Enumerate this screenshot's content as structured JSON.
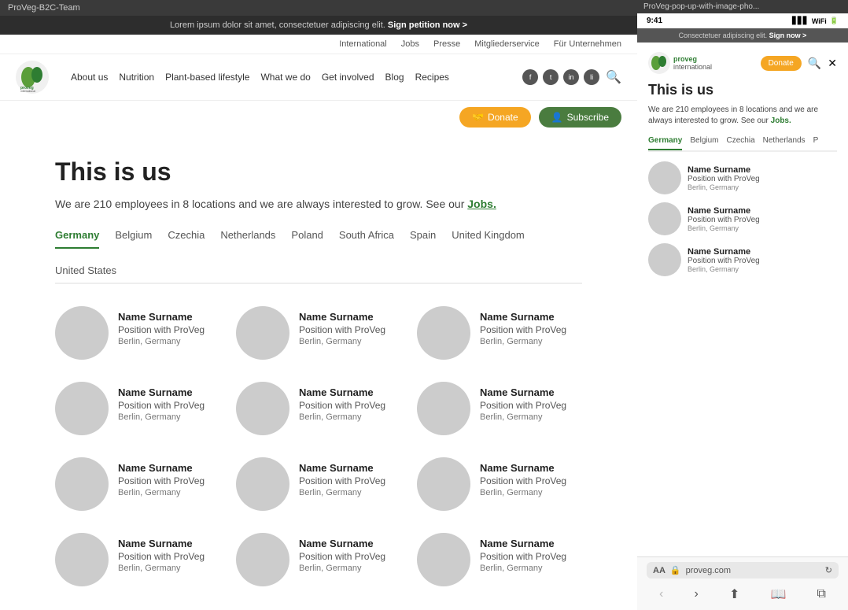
{
  "browser": {
    "left_title": "ProVeg-B2C-Team",
    "right_title": "ProVeg-pop-up-with-image-pho..."
  },
  "banner": {
    "text": "Lorem ipsum dolor sit amet, consectetuer adipiscing elit.",
    "link_text": "Sign petition now >"
  },
  "secondary_nav": {
    "items": [
      "International",
      "Jobs",
      "Presse",
      "Mitgliederservice",
      "Für Unternehmen"
    ]
  },
  "main_nav": {
    "logo_text": "proveg\ninternational",
    "links": [
      "About us",
      "Nutrition",
      "Plant-based lifestyle",
      "What we do",
      "Get involved",
      "Blog",
      "Recipes"
    ]
  },
  "action_buttons": {
    "donate": "Donate",
    "subscribe": "Subscribe"
  },
  "page": {
    "title": "This is us",
    "description": "We are 210 employees in 8 locations and we are always interested to grow. See our",
    "jobs_link": "Jobs."
  },
  "tabs": {
    "items": [
      "Germany",
      "Belgium",
      "Czechia",
      "Netherlands",
      "Poland",
      "South Africa",
      "Spain",
      "United Kingdom",
      "United States"
    ],
    "active": "Germany"
  },
  "team_members": [
    {
      "name": "Name Surname",
      "position": "Position with ProVeg",
      "location": "Berlin, Germany"
    },
    {
      "name": "Name Surname",
      "position": "Position with ProVeg",
      "location": "Berlin, Germany"
    },
    {
      "name": "Name Surname",
      "position": "Position with ProVeg",
      "location": "Berlin, Germany"
    },
    {
      "name": "Name Surname",
      "position": "Position with ProVeg",
      "location": "Berlin, Germany"
    },
    {
      "name": "Name Surname",
      "position": "Position with ProVeg",
      "location": "Berlin, Germany"
    },
    {
      "name": "Name Surname",
      "position": "Position with ProVeg",
      "location": "Berlin, Germany"
    },
    {
      "name": "Name Surname",
      "position": "Position with ProVeg",
      "location": "Berlin, Germany"
    },
    {
      "name": "Name Surname",
      "position": "Position with ProVeg",
      "location": "Berlin, Germany"
    },
    {
      "name": "Name Surname",
      "position": "Position with ProVeg",
      "location": "Berlin, Germany"
    },
    {
      "name": "Name Surname",
      "position": "Position with ProVeg",
      "location": "Berlin, Germany"
    },
    {
      "name": "Name Surname",
      "position": "Position with ProVeg",
      "location": "Berlin, Germany"
    },
    {
      "name": "Name Surname",
      "position": "Position with ProVeg",
      "location": "Berlin, Germany"
    }
  ],
  "mobile": {
    "time": "9:41",
    "url": "proveg.com",
    "banner_text": "Consectetuer adipiscing elit.",
    "banner_link": "Sign now >",
    "page_title": "This is us",
    "page_desc": "We are 210 employees in 8 locations and we are always interested to grow. See our",
    "jobs_link": "Jobs.",
    "tabs": [
      "Germany",
      "Belgium",
      "Czechia",
      "Netherlands",
      "P"
    ],
    "active_tab": "Germany",
    "donate_btn": "Donate",
    "members": [
      {
        "name": "Name Surname",
        "position": "Position with ProVeg",
        "location": "Berlin, Germany"
      },
      {
        "name": "Name Surname",
        "position": "Position with ProVeg",
        "location": "Berlin, Germany"
      },
      {
        "name": "Name Surname",
        "position": "Position with ProVeg",
        "location": "Berlin, Germany"
      }
    ]
  },
  "colors": {
    "green": "#2e7d32",
    "orange": "#f5a623",
    "dark_bg": "#3a3a3a"
  }
}
